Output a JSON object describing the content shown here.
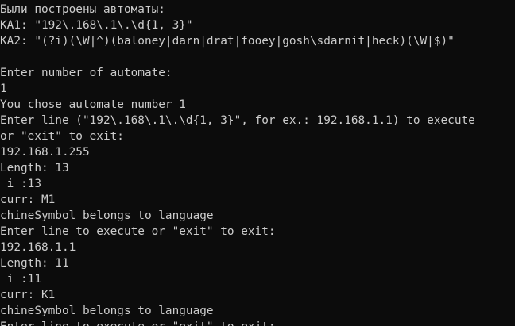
{
  "console": {
    "background": "#0c0c0c",
    "foreground": "#cccccc",
    "lines": [
      "Были построены автоматы:",
      "KA1: \"192\\.168\\.1\\.\\d{1, 3}\"",
      "KA2: \"(?i)(\\W|^)(baloney|darn|drat|fooey|gosh\\sdarnit|heck)(\\W|$)\"",
      "",
      "Enter number of automate:",
      "1",
      "You chose automate number 1",
      "Enter line (\"192\\.168\\.1\\.\\d{1, 3}\", for ex.: 192.168.1.1) to execute",
      "or \"exit\" to exit:",
      "192.168.1.255",
      "Length: 13",
      " i :13",
      "curr: M1",
      "chineSymbol belongs to language",
      "Enter line to execute or \"exit\" to exit:",
      "192.168.1.1",
      "Length: 11",
      " i :11",
      "curr: K1",
      "chineSymbol belongs to language",
      "Enter line to execute or \"exit\" to exit:"
    ]
  }
}
